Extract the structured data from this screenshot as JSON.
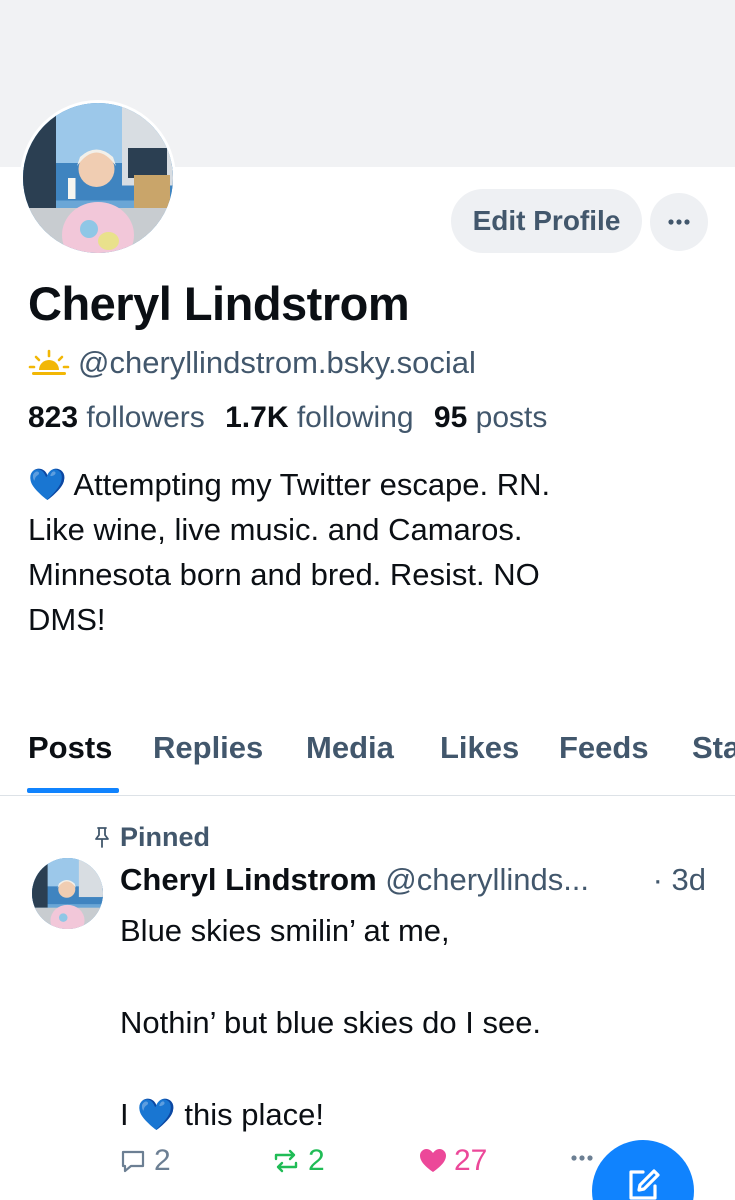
{
  "profile": {
    "name": "Cheryl Lindstrom",
    "handle": "@cheryllindstrom.bsky.social",
    "edit_label": "Edit Profile",
    "followers_count": "823",
    "followers_label": "followers",
    "following_count": "1.7K",
    "following_label": "following",
    "posts_count": "95",
    "posts_label": "posts",
    "bio": "💙 Attempting my Twitter escape.  RN.\nLike wine, live music. and Camaros.\nMinnesota born and bred. Resist.  NO\nDMS!"
  },
  "tabs": [
    "Posts",
    "Replies",
    "Media",
    "Likes",
    "Feeds",
    "Sta"
  ],
  "active_tab": "Posts",
  "post": {
    "pinned_label": "Pinned",
    "author": "Cheryl Lindstrom",
    "handle": "@cheryllinds...",
    "time": "· 3d",
    "text": "Blue skies smilin’ at me,\n\nNothin’ but blue skies do I see.\n\nI 💙 this place!",
    "replies": "2",
    "reposts": "2",
    "likes": "27"
  },
  "icons": {
    "handle_badge": "sunrise-icon",
    "more": "ellipsis-icon",
    "pin": "pin-icon",
    "reply": "comment-icon",
    "repost": "repost-icon",
    "like": "heart-icon",
    "compose": "compose-icon"
  },
  "colors": {
    "accent": "#1083fe",
    "muted_text": "#42576c",
    "repost_active": "#20bc56",
    "like_active": "#ec4899",
    "banner": "#f1f2f4"
  }
}
